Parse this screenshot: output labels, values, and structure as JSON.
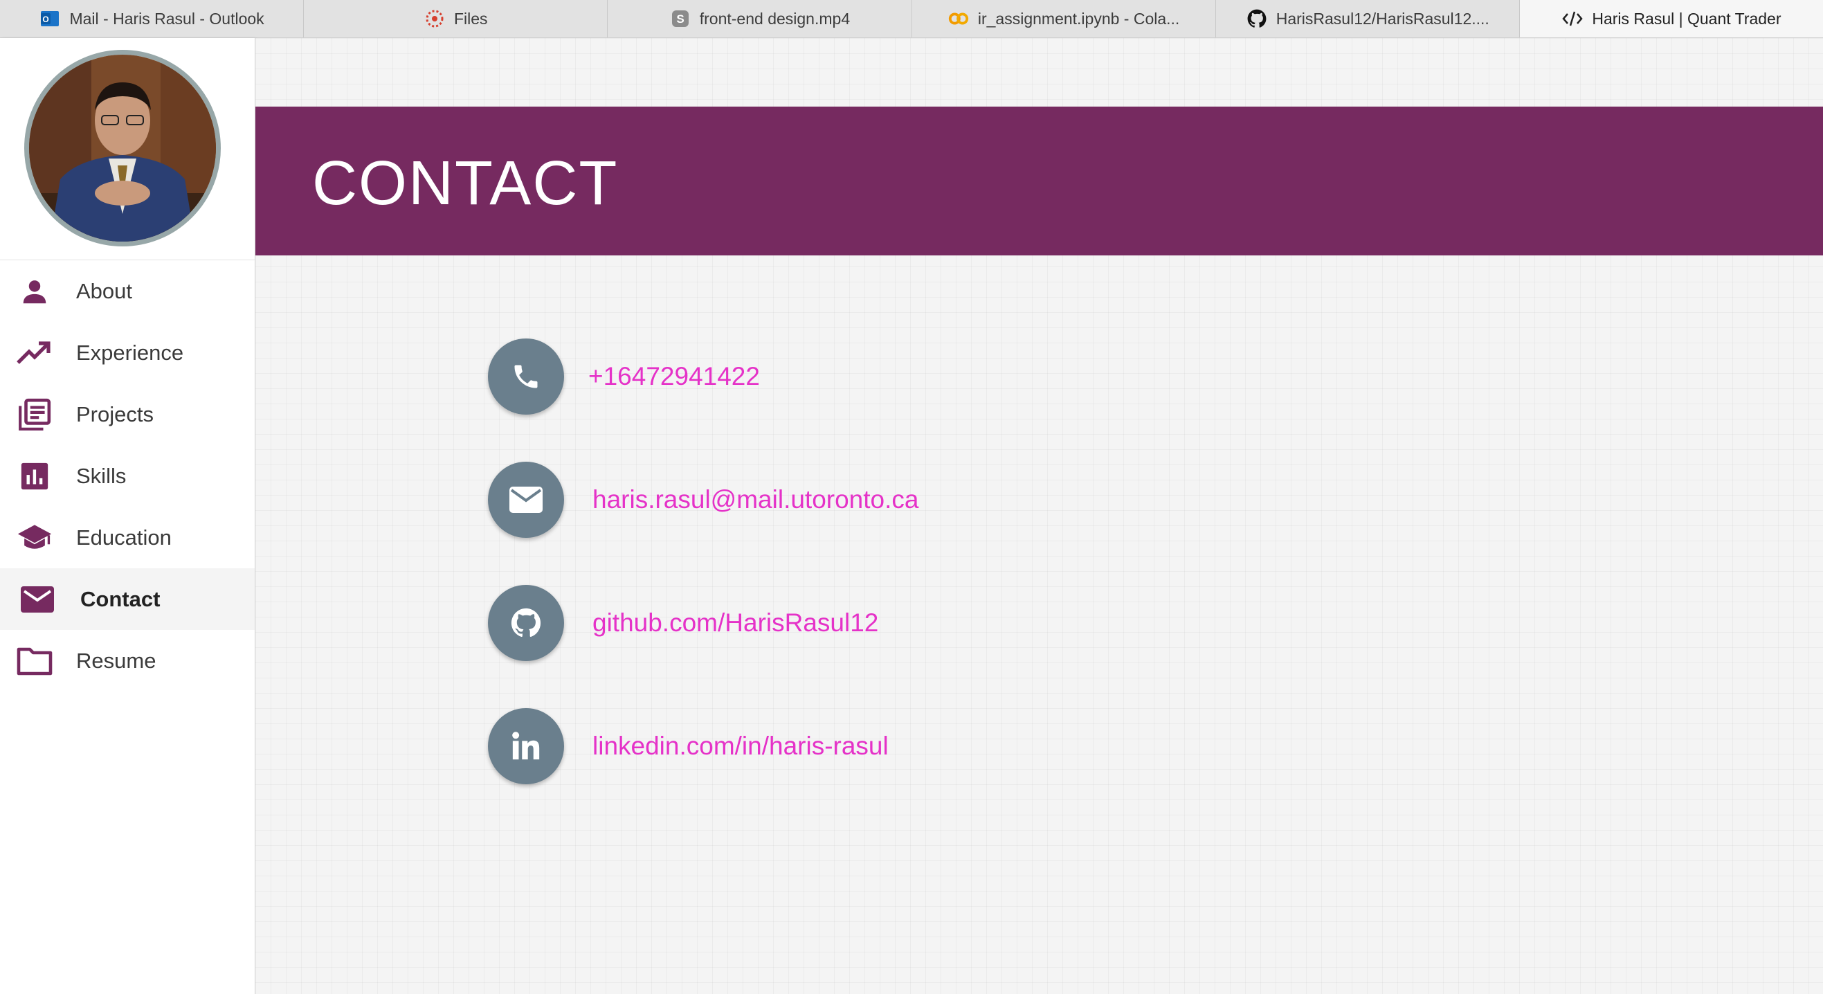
{
  "browser": {
    "tabs": [
      {
        "label": "Mail - Haris Rasul - Outlook",
        "icon": "outlook-icon",
        "active": false
      },
      {
        "label": "Files",
        "icon": "canvas-icon",
        "active": false
      },
      {
        "label": "front-end design.mp4",
        "icon": "stream-icon",
        "active": false
      },
      {
        "label": "ir_assignment.ipynb - Cola...",
        "icon": "colab-icon",
        "active": false
      },
      {
        "label": "HarisRasul12/HarisRasul12....",
        "icon": "github-icon",
        "active": false
      },
      {
        "label": "Haris Rasul | Quant Trader",
        "icon": "code-icon",
        "active": true
      }
    ]
  },
  "sidebar": {
    "items": [
      {
        "label": "About",
        "icon": "person-icon"
      },
      {
        "label": "Experience",
        "icon": "trending-up-icon"
      },
      {
        "label": "Projects",
        "icon": "library-books-icon"
      },
      {
        "label": "Skills",
        "icon": "bar-chart-icon"
      },
      {
        "label": "Education",
        "icon": "school-icon"
      },
      {
        "label": "Contact",
        "icon": "mail-icon",
        "active": true
      },
      {
        "label": "Resume",
        "icon": "folder-icon"
      }
    ]
  },
  "main": {
    "title": "CONTACT",
    "contacts": [
      {
        "text": "+16472941422",
        "icon": "phone-icon"
      },
      {
        "text": "haris.rasul@mail.utoronto.ca",
        "icon": "envelope-icon"
      },
      {
        "text": "github.com/HarisRasul12",
        "icon": "github-icon"
      },
      {
        "text": "linkedin.com/in/haris-rasul",
        "icon": "linkedin-icon"
      }
    ]
  },
  "colors": {
    "accent": "#762a60",
    "link": "#e532c8",
    "icon_circle": "#6a7f8d"
  }
}
